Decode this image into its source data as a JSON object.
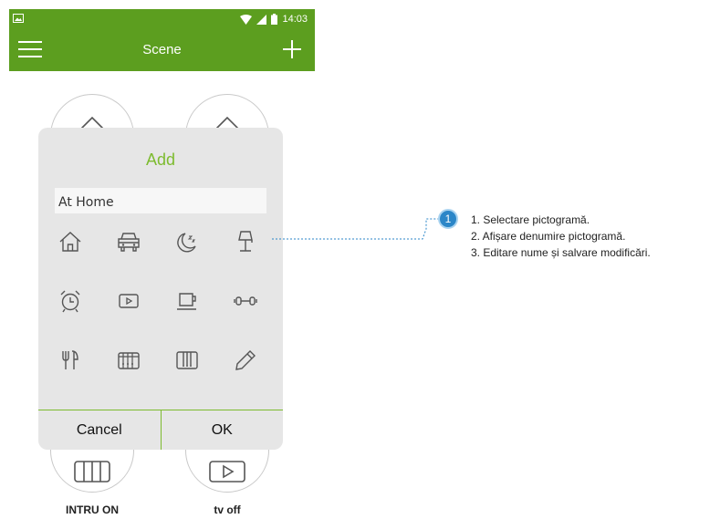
{
  "status_bar": {
    "time": "14:03"
  },
  "app_bar": {
    "title": "Scene"
  },
  "scenes": [
    {
      "label": ""
    },
    {
      "label": ""
    },
    {
      "label": "INTRU ON"
    },
    {
      "label": "tv off"
    }
  ],
  "dialog": {
    "title": "Add",
    "name_value": "At Home",
    "icons": [
      "home-icon",
      "car-icon",
      "moon-sleep-icon",
      "lamp-icon",
      "alarm-clock-icon",
      "tv-play-icon",
      "coffee-cup-icon",
      "dumbbell-icon",
      "dining-icon",
      "piano-icon",
      "curtain-icon",
      "pencil-icon"
    ],
    "cancel_label": "Cancel",
    "ok_label": "OK"
  },
  "annotation": {
    "badge": "1",
    "steps": [
      "1. Selectare pictogramă.",
      "2. Afișare denumire pictogramă.",
      "3. Editare nume și salvare modificări."
    ]
  },
  "colors": {
    "app_green": "#5c9e1f",
    "accent_green": "#7dbb2f",
    "dialog_bg": "#e6e6e6",
    "callout_blue": "#2b86c8"
  }
}
